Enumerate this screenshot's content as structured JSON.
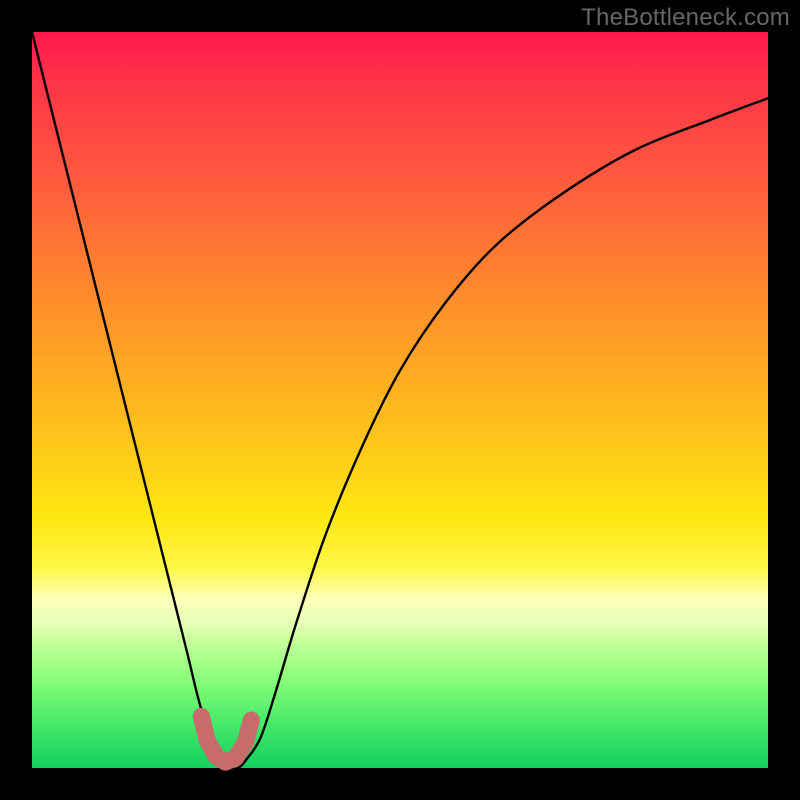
{
  "watermark": "TheBottleneck.com",
  "chart_data": {
    "type": "line",
    "title": "",
    "xlabel": "",
    "ylabel": "",
    "xlim": [
      0,
      100
    ],
    "ylim": [
      0,
      100
    ],
    "series": [
      {
        "name": "bottleneck-curve",
        "x": [
          0,
          5,
          10,
          15,
          18,
          21,
          23,
          25,
          26,
          27,
          28,
          29,
          31,
          33,
          36,
          40,
          45,
          50,
          56,
          63,
          72,
          82,
          92,
          100
        ],
        "values": [
          100,
          80,
          60,
          40,
          28,
          16,
          8,
          3,
          1,
          0,
          0,
          1,
          4,
          10,
          20,
          32,
          44,
          54,
          63,
          71,
          78,
          84,
          88,
          91
        ]
      },
      {
        "name": "marker-dots",
        "x": [
          23.0,
          23.8,
          25.0,
          26.3,
          27.7,
          29.0,
          29.8
        ],
        "values": [
          7.0,
          3.8,
          1.6,
          0.8,
          1.4,
          3.5,
          6.5
        ]
      }
    ],
    "colors": {
      "curve": "#000000",
      "markers": "#c86b6b",
      "gradient_top": "#ff1a4d",
      "gradient_bottom": "#12d05c"
    }
  }
}
